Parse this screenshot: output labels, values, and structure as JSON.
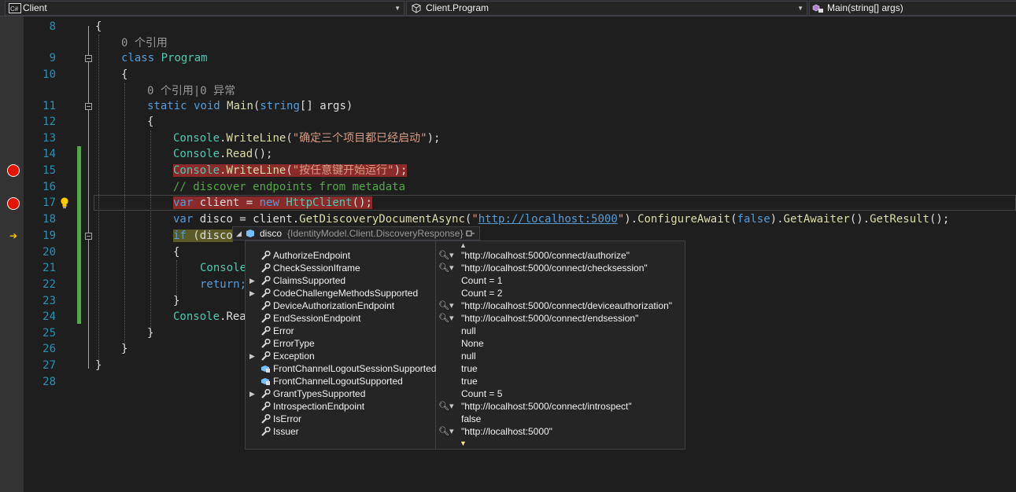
{
  "nav": {
    "project": "Client",
    "type": "Client.Program",
    "member": "Main(string[] args)"
  },
  "editor": {
    "line_numbers": [
      "8",
      "9",
      "10",
      "11",
      "12",
      "13",
      "14",
      "15",
      "16",
      "17",
      "18",
      "19",
      "20",
      "21",
      "22",
      "23",
      "24",
      "25",
      "26",
      "27",
      "28"
    ],
    "codelens": {
      "class_refs": "0 个引用",
      "method_refs": "0 个引用|0 异常"
    },
    "lines": {
      "l8": "{",
      "l9_kw": "class",
      "l9_type": "Program",
      "l10": "{",
      "l11_kw1": "static",
      "l11_kw2": "void",
      "l11_name": "Main",
      "l11_open": "(",
      "l11_kw3": "string",
      "l11_rest": "[] args)",
      "l12": "{",
      "l13_type": "Console",
      "l13_dot": ".",
      "l13_method": "WriteLine",
      "l13_open": "(",
      "l13_str": "\"确定三个项目都已经启动\"",
      "l13_close": ");",
      "l14_type": "Console",
      "l14_dot": ".",
      "l14_method": "Read",
      "l14_rest": "();",
      "l15_type": "Console",
      "l15_dot": ".",
      "l15_method": "WriteLine",
      "l15_open": "(",
      "l15_str": "\"按任意键开始运行\"",
      "l15_close": ");",
      "l16_comment": "// discover endpoints from metadata",
      "l17_kw": "var",
      "l17_mid": " client = ",
      "l17_kw2": "new",
      "l17_type": "HttpClient",
      "l17_rest": "();",
      "l18_kw": "var",
      "l18_a": " disco = client.",
      "l18_m1": "GetDiscoveryDocumentAsync",
      "l18_open": "(",
      "l18_q1": "\"",
      "l18_url": "http://localhost:5000",
      "l18_q2": "\"",
      "l18_b": ").",
      "l18_m2": "ConfigureAwait",
      "l18_c": "(",
      "l18_kw2": "false",
      "l18_d": ").",
      "l18_m3": "GetAwaiter",
      "l18_e": "().",
      "l18_m4": "GetResult",
      "l18_f": "();",
      "l19_kw": "if",
      "l19_rest": " (disco",
      "l20": "{",
      "l21_type": "Console",
      "l22_kw": "return;",
      "l23": "}",
      "l24_type": "Console",
      "l24_rest": ".Rea",
      "l25": "}",
      "l26": "}",
      "l27": "}"
    }
  },
  "datatip": {
    "header_name": "disco",
    "header_type": "{IdentityModel.Client.DiscoveryResponse}",
    "rows": [
      {
        "name": "AuthorizeEndpoint",
        "value": "\"http://localhost:5000/connect/authorize\"",
        "icon": "wrench-icon"
      },
      {
        "name": "CheckSessionIframe",
        "value": "\"http://localhost:5000/connect/checksession\"",
        "icon": "wrench-icon"
      },
      {
        "name": "ClaimsSupported",
        "value": "Count = 1",
        "icon": "wrench-icon"
      },
      {
        "name": "CodeChallengeMethodsSupported",
        "value": "Count = 2",
        "icon": "wrench-icon"
      },
      {
        "name": "DeviceAuthorizationEndpoint",
        "value": "\"http://localhost:5000/connect/deviceauthorization\"",
        "icon": "wrench-icon"
      },
      {
        "name": "EndSessionEndpoint",
        "value": "\"http://localhost:5000/connect/endsession\"",
        "icon": "wrench-icon"
      },
      {
        "name": "Error",
        "value": "null",
        "icon": "wrench-icon"
      },
      {
        "name": "ErrorType",
        "value": "None",
        "icon": "wrench-icon"
      },
      {
        "name": "Exception",
        "value": "null",
        "icon": "wrench-icon"
      },
      {
        "name": "FrontChannelLogoutSessionSupported",
        "value": "true",
        "icon": "field-icon"
      },
      {
        "name": "FrontChannelLogoutSupported",
        "value": "true",
        "icon": "field-icon"
      },
      {
        "name": "GrantTypesSupported",
        "value": "Count = 5",
        "icon": "wrench-icon"
      },
      {
        "name": "IntrospectionEndpoint",
        "value": "\"http://localhost:5000/connect/introspect\"",
        "icon": "wrench-icon"
      },
      {
        "name": "IsError",
        "value": "false",
        "icon": "wrench-icon"
      },
      {
        "name": "Issuer",
        "value": "\"http://localhost:5000\"",
        "icon": "wrench-icon"
      }
    ]
  }
}
